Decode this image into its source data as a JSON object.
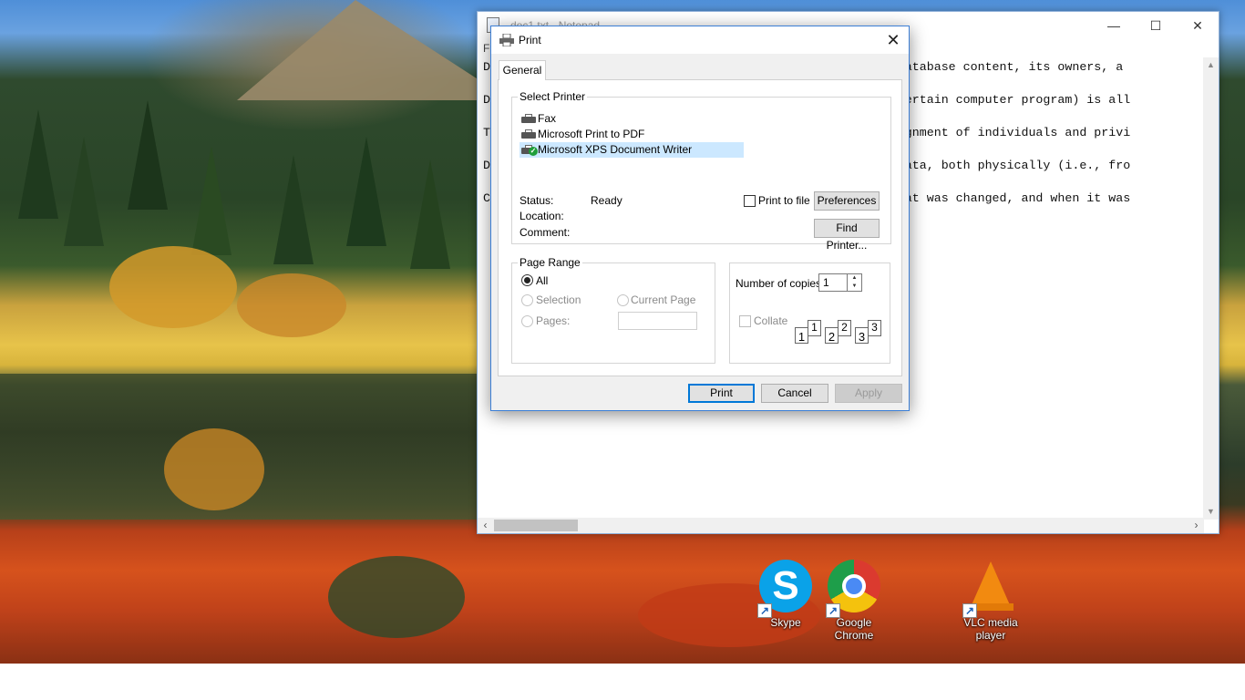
{
  "desktop": {
    "shortcuts": [
      {
        "label": "Skype",
        "icon": "skype-icon"
      },
      {
        "label": "Google Chrome",
        "icon": "chrome-icon"
      },
      {
        "label": "VLC media player",
        "icon": "vlc-icon"
      }
    ]
  },
  "notepad": {
    "title": "doc1.txt - Notepad",
    "menu_file": "Fi",
    "controls": {
      "minimize": "—",
      "maximize": "☐",
      "close": "✕"
    },
    "lines": [
      "D                                                ing the database content, its owners, a",
      "",
      "D                                                on or a certain computer program) is all",
      "",
      "T                                                 the assignment of individuals and privi",
      "",
      "D                                                unks of data, both physically (i.e., fro",
      "",
      "C                                                butes, what was changed, and when it was"
    ]
  },
  "print_dialog": {
    "title": "Print",
    "close": "✕",
    "tab": "General",
    "select_printer": {
      "legend": "Select Printer",
      "printers": [
        {
          "name": "Fax",
          "selected": false
        },
        {
          "name": "Microsoft Print to PDF",
          "selected": false
        },
        {
          "name": "Microsoft XPS Document Writer",
          "selected": true
        }
      ],
      "status_label": "Status:",
      "status_value": "Ready",
      "location_label": "Location:",
      "comment_label": "Comment:",
      "print_to_file": "Print to file",
      "preferences": "Preferences",
      "find_printer": "Find Printer..."
    },
    "page_range": {
      "legend": "Page Range",
      "all": "All",
      "selection": "Selection",
      "current_page": "Current Page",
      "pages": "Pages:"
    },
    "copies": {
      "label": "Number of copies:",
      "value": "1",
      "collate": "Collate",
      "collate_pages": [
        "1",
        "1",
        "2",
        "2",
        "3",
        "3"
      ]
    },
    "buttons": {
      "print": "Print",
      "cancel": "Cancel",
      "apply": "Apply"
    }
  }
}
